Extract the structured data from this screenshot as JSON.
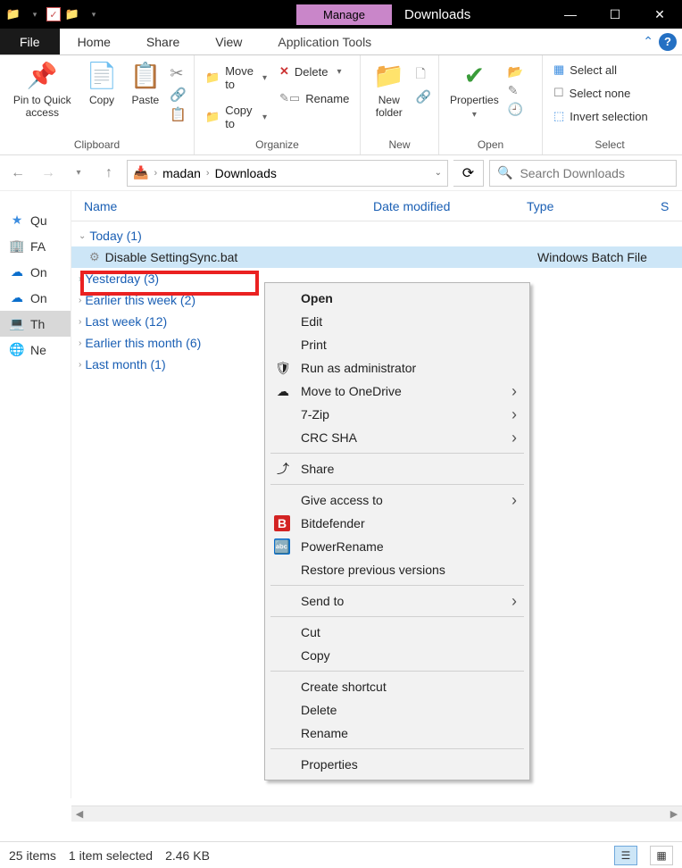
{
  "titlebar": {
    "contextual_tab": "Manage",
    "title": "Downloads"
  },
  "tabs": {
    "file": "File",
    "home": "Home",
    "share": "Share",
    "view": "View",
    "apptools": "Application Tools"
  },
  "ribbon": {
    "clipboard": {
      "label": "Clipboard",
      "pin": "Pin to Quick access",
      "copy": "Copy",
      "paste": "Paste"
    },
    "organize": {
      "label": "Organize",
      "moveto": "Move to",
      "copyto": "Copy to",
      "delete": "Delete",
      "rename": "Rename"
    },
    "new": {
      "label": "New",
      "newfolder": "New folder"
    },
    "open": {
      "label": "Open",
      "properties": "Properties"
    },
    "select": {
      "label": "Select",
      "selectall": "Select all",
      "selectnone": "Select none",
      "invert": "Invert selection"
    }
  },
  "address": {
    "seg1": "madan",
    "seg2": "Downloads"
  },
  "search": {
    "placeholder": "Search Downloads"
  },
  "columns": {
    "name": "Name",
    "date": "Date modified",
    "type": "Type",
    "size": "S"
  },
  "nav": [
    {
      "icon": "★",
      "label": "Qu",
      "color": "#3c8de0"
    },
    {
      "icon": "🏢",
      "label": "FA",
      "color": "#2d5aa8"
    },
    {
      "icon": "☁",
      "label": "On",
      "color": "#0a6ecc"
    },
    {
      "icon": "☁",
      "label": "On",
      "color": "#0a6ecc"
    },
    {
      "icon": "💻",
      "label": "Th",
      "color": "#2a78c9",
      "sel": true
    },
    {
      "icon": "🌐",
      "label": "Ne",
      "color": "#2aa0c9"
    }
  ],
  "groups": {
    "today": "Today (1)",
    "yesterday": "Yesterday (3)",
    "thisweek": "Earlier this week (2)",
    "lastweek": "Last week (12)",
    "thismonth": "Earlier this month (6)",
    "lastmonth": "Last month (1)"
  },
  "selected_file": {
    "name": "Disable SettingSync.bat",
    "type": "Windows Batch File"
  },
  "contextmenu": [
    {
      "label": "Open",
      "bold": true
    },
    {
      "label": "Edit"
    },
    {
      "label": "Print"
    },
    {
      "label": "Run as administrator",
      "icon": "🛡"
    },
    {
      "label": "Move to OneDrive",
      "icon": "☁",
      "arrow": true
    },
    {
      "label": "7-Zip",
      "arrow": true
    },
    {
      "label": "CRC SHA",
      "arrow": true
    },
    {
      "label": "Share",
      "icon": "⤴",
      "sep_before": true
    },
    {
      "label": "Give access to",
      "arrow": true,
      "sep_before": true
    },
    {
      "label": "Bitdefender",
      "icon": "B",
      "iconbg": "#d32323"
    },
    {
      "label": "PowerRename",
      "icon": "🔤",
      "iconbg": "#0a6ecc"
    },
    {
      "label": "Restore previous versions"
    },
    {
      "label": "Send to",
      "arrow": true,
      "sep_before": true
    },
    {
      "label": "Cut",
      "sep_before": true
    },
    {
      "label": "Copy"
    },
    {
      "label": "Create shortcut",
      "sep_before": true
    },
    {
      "label": "Delete"
    },
    {
      "label": "Rename"
    },
    {
      "label": "Properties",
      "sep_before": true
    }
  ],
  "status": {
    "items": "25 items",
    "selected": "1 item selected",
    "size": "2.46 KB"
  }
}
